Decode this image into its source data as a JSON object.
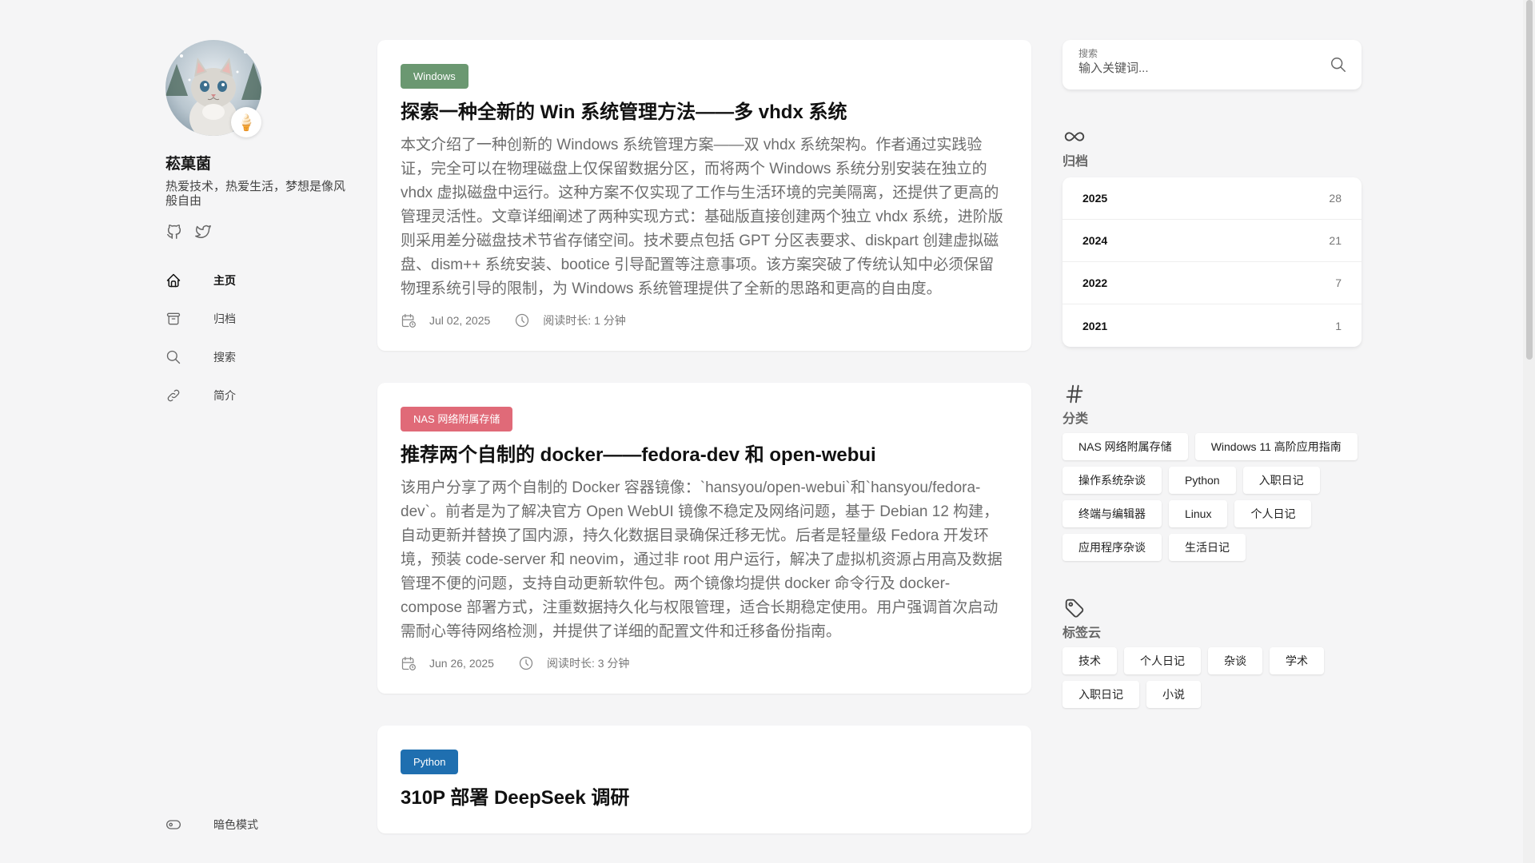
{
  "profile": {
    "name": "菘菓菌",
    "description": "热爱技术，热爱生活，梦想是像风般自由",
    "badge_emoji": "🍦"
  },
  "socials": [
    {
      "icon": "github-icon"
    },
    {
      "icon": "twitter-icon"
    }
  ],
  "nav": {
    "items": [
      {
        "label": "主页",
        "icon": "home-icon",
        "active": true
      },
      {
        "label": "归档",
        "icon": "archive-icon",
        "active": false
      },
      {
        "label": "搜索",
        "icon": "search-icon",
        "active": false
      },
      {
        "label": "简介",
        "icon": "link-icon",
        "active": false
      }
    ],
    "dark_mode_label": "暗色模式"
  },
  "posts": [
    {
      "category": "Windows",
      "category_color": "#6b9871",
      "title": "探索一种全新的 Win 系统管理方法——多 vhdx 系统",
      "summary": "本文介绍了一种创新的 Windows 系统管理方案——双 vhdx 系统架构。作者通过实践验证，完全可以在物理磁盘上仅保留数据分区，而将两个 Windows 系统分别安装在独立的 vhdx 虚拟磁盘中运行。这种方案不仅实现了工作与生活环境的完美隔离，还提供了更高的管理灵活性。文章详细阐述了两种实现方式：基础版直接创建两个独立 vhdx 系统，进阶版则采用差分磁盘技术节省存储空间。技术要点包括 GPT 分区表要求、diskpart 创建虚拟磁盘、dism++ 系统安装、bootice 引导配置等注意事项。该方案突破了传统认知中必须保留物理系统引导的限制，为 Windows 系统管理提供了全新的思路和更高的自由度。",
      "date": "Jul 02, 2025",
      "read_time": "阅读时长: 1 分钟"
    },
    {
      "category": "NAS 网络附属存储",
      "category_color": "#e06a78",
      "title": "推荐两个自制的 docker——fedora-dev 和 open-webui",
      "summary": "该用户分享了两个自制的 Docker 容器镜像：`hansyou/open-webui`和`hansyou/fedora-dev`。前者是为了解决官方 Open WebUI 镜像不稳定及网络问题，基于 Debian 12 构建，自动更新并替换了国内源，持久化数据目录确保迁移无忧。后者是轻量级 Fedora 开发环境，预装 code-server 和 neovim，通过非 root 用户运行，解决了虚拟机资源占用高及数据管理不便的问题，支持自动更新软件包。两个镜像均提供 docker 命令行及 docker-compose 部署方式，注重数据持久化与权限管理，适合长期稳定使用。用户强调首次启动需耐心等待网络检测，并提供了详细的配置文件和迁移备份指南。",
      "date": "Jun 26, 2025",
      "read_time": "阅读时长: 3 分钟"
    },
    {
      "category": "Python",
      "category_color": "#1f6fb0",
      "title": "310P 部署 DeepSeek 调研",
      "summary": "",
      "date": "",
      "read_time": ""
    }
  ],
  "search": {
    "label": "搜索",
    "placeholder": "输入关键词..."
  },
  "archives": {
    "title": "归档",
    "rows": [
      {
        "year": "2025",
        "count": "28"
      },
      {
        "year": "2024",
        "count": "21"
      },
      {
        "year": "2022",
        "count": "7"
      },
      {
        "year": "2021",
        "count": "1"
      }
    ]
  },
  "categories": {
    "title": "分类",
    "items": [
      "NAS 网络附属存储",
      "Windows 11 高阶应用指南",
      "操作系统杂谈",
      "Python",
      "入职日记",
      "终端与编辑器",
      "Linux",
      "个人日记",
      "应用程序杂谈",
      "生活日记"
    ]
  },
  "tags": {
    "title": "标签云",
    "items": [
      "技术",
      "个人日记",
      "杂谈",
      "学术",
      "入职日记",
      "小说"
    ]
  }
}
